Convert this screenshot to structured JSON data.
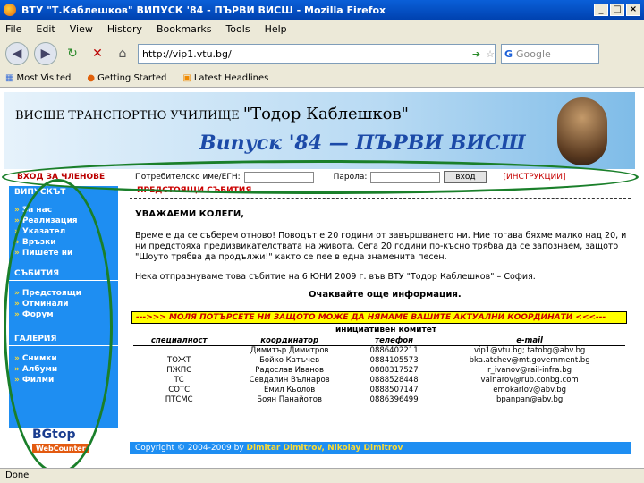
{
  "window": {
    "title": "ВТУ \"Т.Каблешков\" ВИПУСК '84 - ПЪРВИ ВИСШ - Mozilla Firefox",
    "buttons": [
      "_",
      "□",
      "×"
    ]
  },
  "menu": [
    "File",
    "Edit",
    "View",
    "History",
    "Bookmarks",
    "Tools",
    "Help"
  ],
  "nav": {
    "url": "http://vip1.vtu.bg/",
    "search_placeholder": "Google"
  },
  "bookmarks": [
    "Most Visited",
    "Getting Started",
    "Latest Headlines"
  ],
  "banner": {
    "line1_prefix": "ВИСШЕ ТРАНСПОРТНО УЧИЛИЩЕ ",
    "line1_name": "\"Тодор Каблешков\"",
    "line2": "Випуск '84 — ПЪРВИ ВИСШ"
  },
  "login": {
    "title": "ВХОД ЗА ЧЛЕНОВЕ",
    "user_label": "Потребителско име/ЕГН:",
    "pass_label": "Парола:",
    "button": "вход",
    "instructions": "[ИНСТРУКЦИИ]"
  },
  "sidebar": {
    "sections": [
      {
        "title": "ВИПУСКЪТ",
        "items": [
          "За нас",
          "Реализация",
          "Указател",
          "Връзки",
          "Пишете ни"
        ]
      },
      {
        "title": "СЪБИТИЯ",
        "items": [
          "Предстоящи",
          "Отминали",
          "Форум"
        ]
      },
      {
        "title": "ГАЛЕРИЯ",
        "items": [
          "Снимки",
          "Албуми",
          "Филми"
        ]
      }
    ],
    "counter_logo": "BGtop",
    "counter_label": "WebCounter"
  },
  "main": {
    "heading": "ПРЕДСТОЯЩИ СЪБИТИЯ",
    "greeting": "УВАЖАЕМИ КОЛЕГИ,",
    "paragraph1": "Време е да се съберем отново! Поводът е 20 години от завършването ни. Ние тогава бяхме малко над 20, и ни предстояха предизвикателствата на живота. Сега 20 години по-късно трябва да се запознаем, защото \"Шоуто трябва да продължи!\" както се пее в една знаменита песен.",
    "paragraph2": "Нека отпразнуваме това събитие на 6 ЮНИ 2009 г. във ВТУ \"Тодор Каблешков\" – София.",
    "paragraph3": "Очаквайте още информация.",
    "warning": "--->>> МОЛЯ ПОТЪРСЕТЕ НИ ЗАЩОТО МОЖЕ ДА НЯМАМЕ ВАШИТЕ АКТУАЛНИ КООРДИНАТИ <<<---",
    "committee_title": "инициативен комитет",
    "table_headers": [
      "специалност",
      "координатор",
      "телефон",
      "e-mail"
    ],
    "table_rows": [
      [
        "",
        "Димитър Димитров",
        "0886402211",
        "vip1@vtu.bg; tatobg@abv.bg"
      ],
      [
        "ТОЖТ",
        "Бойко Катъчев",
        "0884105573",
        "bka.atchev@mt.government.bg"
      ],
      [
        "ПЖПС",
        "Радослав Иванов",
        "0888317527",
        "r_ivanov@rail-infra.bg"
      ],
      [
        "ТС",
        "Севдалин Вълнаров",
        "0888528448",
        "valnarov@rub.conbg.com"
      ],
      [
        "СОТС",
        "Емил Кьолов",
        "0888507147",
        "emokarlov@abv.bg"
      ],
      [
        "ПТСМС",
        "Боян Панайотов",
        "0886396499",
        "bpanpan@abv.bg"
      ]
    ]
  },
  "footer": {
    "copyright": "Copyright © 2004-2009 by ",
    "authors": "Dimitar Dimitrov, Nikolay Dimitrov"
  },
  "status": "Done"
}
